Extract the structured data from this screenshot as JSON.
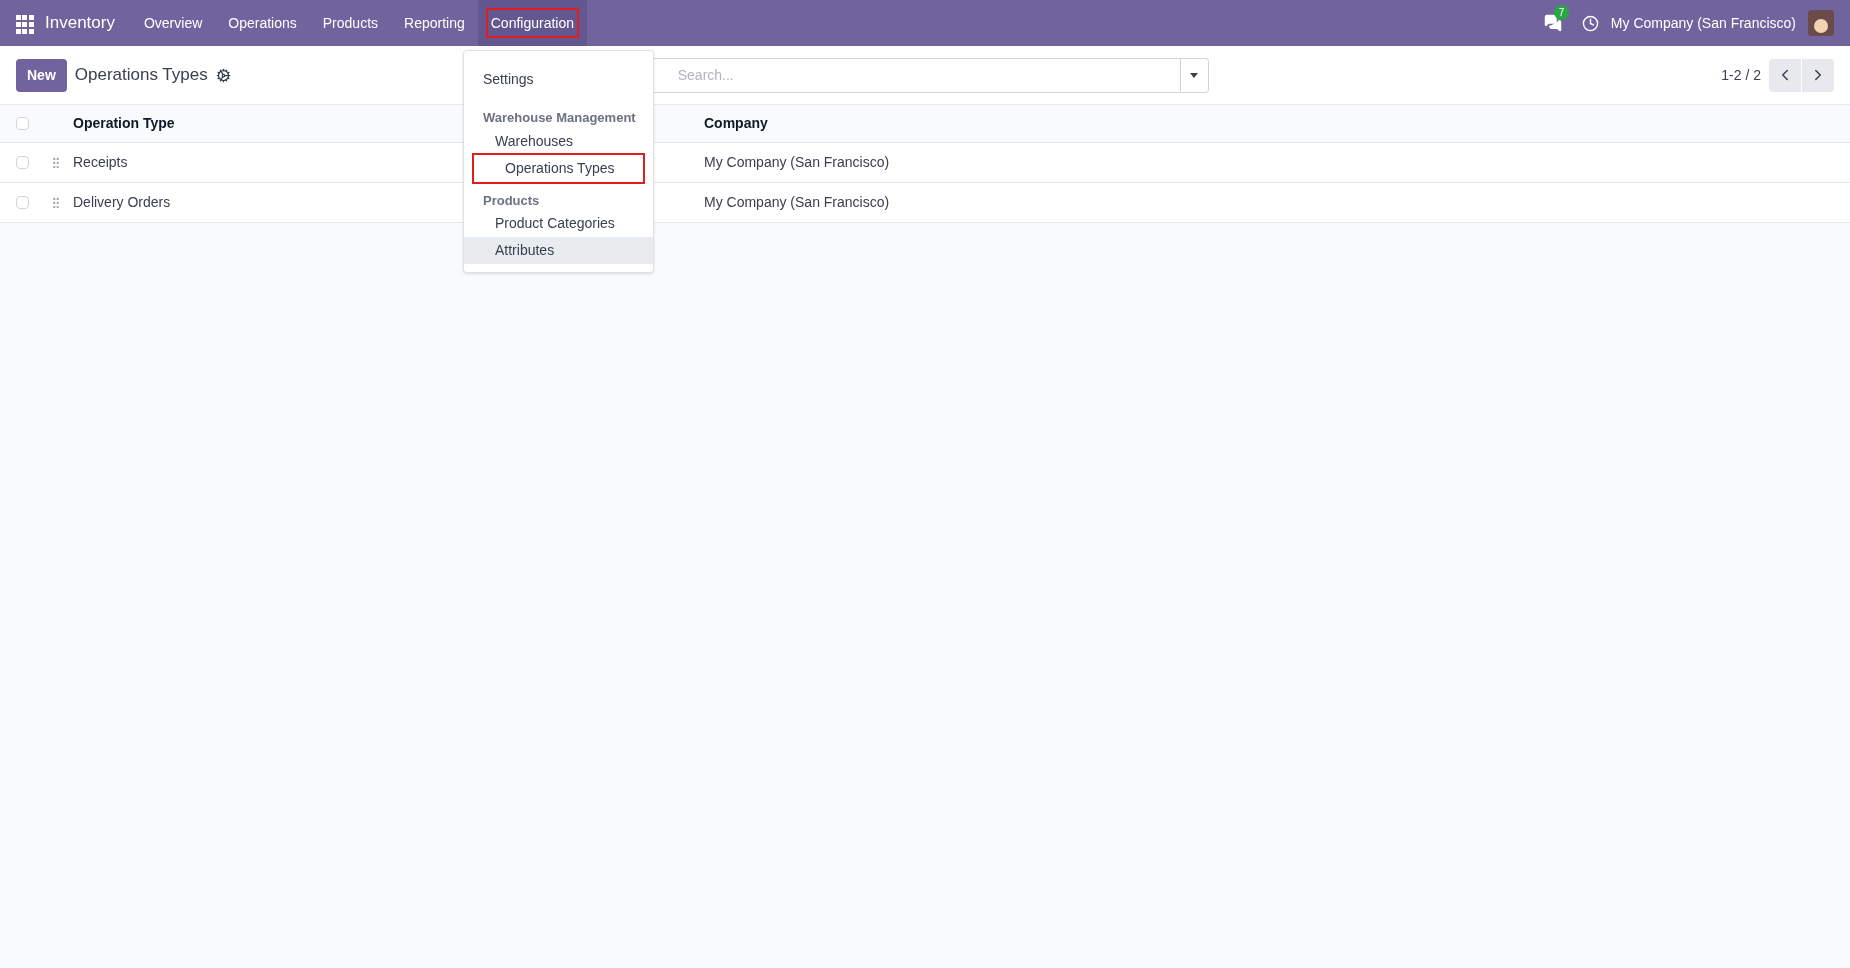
{
  "navbar": {
    "app_name": "Inventory",
    "menus": [
      {
        "label": "Overview",
        "selected": false,
        "highlighted": false
      },
      {
        "label": "Operations",
        "selected": false,
        "highlighted": false
      },
      {
        "label": "Products",
        "selected": false,
        "highlighted": false
      },
      {
        "label": "Reporting",
        "selected": false,
        "highlighted": false
      },
      {
        "label": "Configuration",
        "selected": true,
        "highlighted": true
      }
    ],
    "messages_badge": "7",
    "company": "My Company (San Francisco)"
  },
  "dropdown": {
    "items": [
      {
        "kind": "item",
        "label": "Settings",
        "selected": false,
        "highlighted": false
      },
      {
        "kind": "header",
        "label": "Warehouse Management"
      },
      {
        "kind": "subitem",
        "label": "Warehouses",
        "selected": false,
        "highlighted": false
      },
      {
        "kind": "subitem",
        "label": "Operations Types",
        "selected": false,
        "highlighted": true
      },
      {
        "kind": "header",
        "label": "Products"
      },
      {
        "kind": "subitem",
        "label": "Product Categories",
        "selected": false,
        "highlighted": false
      },
      {
        "kind": "subitem",
        "label": "Attributes",
        "selected": true,
        "highlighted": false
      }
    ]
  },
  "control_panel": {
    "new_button": "New",
    "title": "Operations Types",
    "search": {
      "placeholder": "Search..."
    },
    "pager": "1-2 / 2"
  },
  "table": {
    "select_all_checked": false,
    "columns": [
      "Operation Type",
      "Company"
    ],
    "rows": [
      {
        "cells": [
          "Receipts",
          "My Company (San Francisco)"
        ],
        "checked": false
      },
      {
        "cells": [
          "Delivery Orders",
          "My Company (San Francisco)"
        ],
        "checked": false
      }
    ]
  }
}
